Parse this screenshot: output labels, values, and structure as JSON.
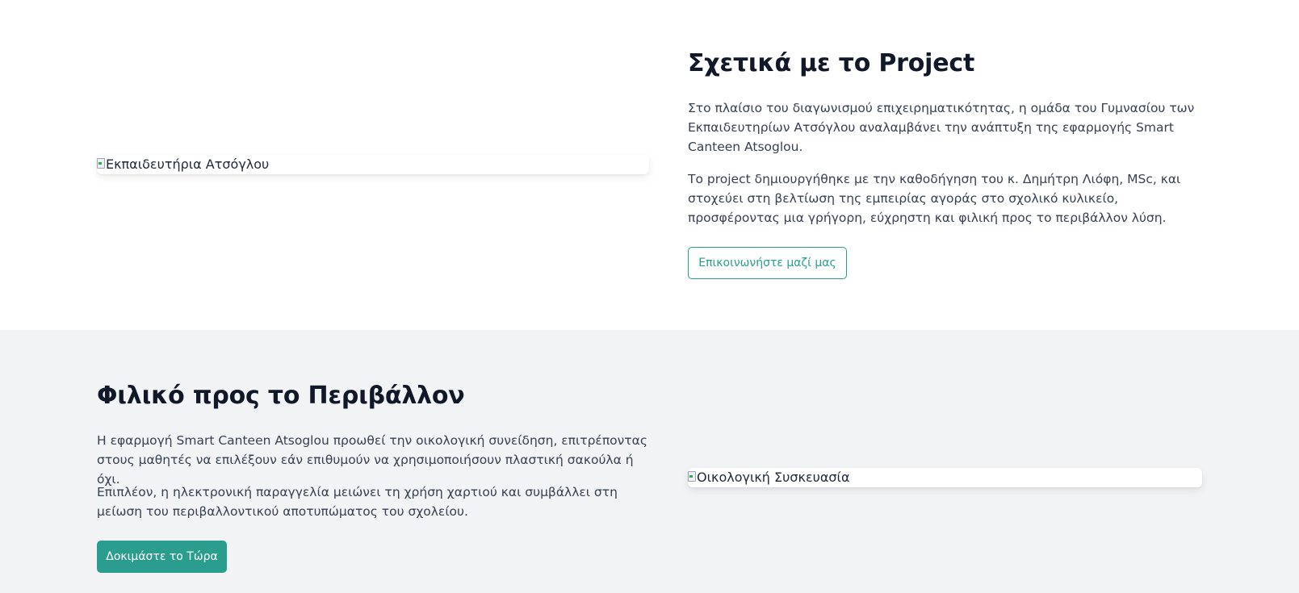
{
  "about": {
    "image_alt": "Εκπαιδευτήρια Ατσόγλου",
    "title": "Σχετικά με το Project",
    "paragraph_1": "Στο πλαίσιο του διαγωνισμού επιχειρηματικότητας, η ομάδα του Γυμνασίου των Εκπαιδευτηρίων Ατσόγλου αναλαμβάνει την ανάπτυξη της εφαρμογής Smart Canteen Atsoglou.",
    "paragraph_2": "Το project δημιουργήθηκε με την καθοδήγηση του κ. Δημήτρη Λιόφη, MSc, και στοχεύει στη βελτίωση της εμπειρίας αγοράς στο σχολικό κυλικείο, προσφέροντας μια γρήγορη, εύχρηστη και φιλική προς το περιβάλλον λύση.",
    "contact_button": "Επικοινωνήστε μαζί μας"
  },
  "eco": {
    "title": "Φιλικό προς το Περιβάλλον",
    "paragraph_1": "Η εφαρμογή Smart Canteen Atsoglou προωθεί την οικολογική συνείδηση, επιτρέποντας στους μαθητές να επιλέξουν εάν επιθυμούν να χρησιμοποιήσουν πλαστική σακούλα ή όχι.",
    "paragraph_2": "Επιπλέον, η ηλεκτρονική παραγγελία μειώνει τη χρήση χαρτιού και συμβάλλει στη μείωση του περιβαλλοντικού αποτυπώματος του σχολείου.",
    "try_button": "Δοκιμάστε το Τώρα",
    "image_alt": "Οικολογική Συσκευασία"
  },
  "colors": {
    "accent": "#2a9d8f",
    "section_alt_bg": "#f2f3f5",
    "heading": "#111827",
    "body_text": "#374151"
  }
}
